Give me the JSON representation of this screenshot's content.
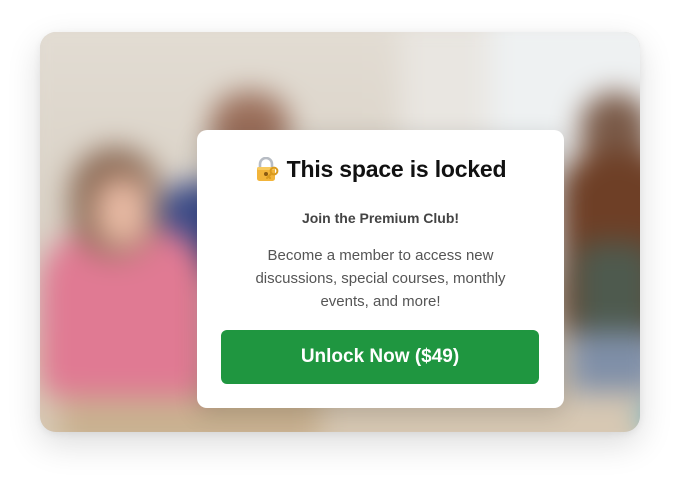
{
  "modal": {
    "icon": "lock-with-key-icon",
    "title": "This space is locked",
    "subtitle": "Join the Premium Club!",
    "description": "Become a member to access new discussions, special courses, monthly events, and more!",
    "button_label": "Unlock Now ($49)"
  },
  "colors": {
    "button_bg": "#1f9640",
    "button_text": "#ffffff",
    "title_text": "#111111",
    "modal_bg": "#ffffff"
  }
}
